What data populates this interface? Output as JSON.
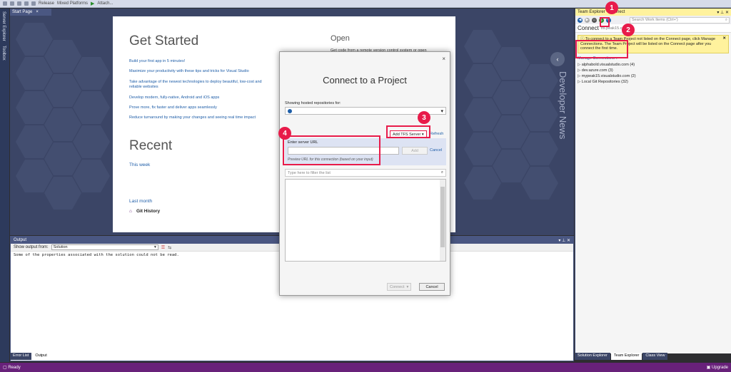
{
  "toolbar": {
    "config": "Release",
    "platform": "Mixed Platforms",
    "attach": "Attach..."
  },
  "left_tabs": [
    "Server Explorer",
    "Toolbox"
  ],
  "start_page": {
    "tab_label": "Start Page",
    "tab_close": "×",
    "get_started": "Get Started",
    "links": [
      "Build your first app in 5 minutes!",
      "Maximize your productivity with these tips and tricks for Visual Studio",
      "Take advantage of the newest technologies to deploy beautiful, low-cost and",
      "reliable websites",
      "Develop modern, fully-native, Android and iOS apps",
      "Prove more, fix faster and deliver apps seamlessly",
      "Reduce turnaround by making your changes and seeing real time impact"
    ],
    "open_heading": "Open",
    "open_sub": "Get code from a remote version control system or open",
    "recent_heading": "Recent",
    "this_week": "This week",
    "last_month": "Last month",
    "git_history": "Git History"
  },
  "developer_news": {
    "label": "Developer News",
    "toggle": "‹"
  },
  "output": {
    "title": "Output",
    "pin": "▾ ⊥ ✕",
    "show_from_label": "Show output from:",
    "source": "Solution",
    "message": "Some of the properties associated with the solution could not be read."
  },
  "bottom_tabs": [
    "Error List",
    "Output"
  ],
  "status": {
    "ready": "Ready",
    "upgrade": "Upgrade"
  },
  "team_explorer": {
    "title": "Team Explorer - Connect",
    "title_controls": "▾ ⊥ ✕",
    "search_placeholder": "Search Work Items (Ctrl+')",
    "connect_label": "Connect",
    "server": "tfs.peak15.com",
    "info_message": "To connect to a Team Project not listed on the Connect page, click Manage Connections. The Team Project will be listed on the Connect page after you connect the first time.",
    "manage_connections": "Manage Connections ▾",
    "items": [
      "alphabold.visualstudio.com (4)",
      "dev.azure.com (3)",
      "mypeak15.visualstudio.com (2)",
      "Local Git Repositories (32)"
    ],
    "tabs": [
      "Solution Explorer",
      "Team Explorer",
      "Class View"
    ]
  },
  "dialog": {
    "close": "×",
    "title": "Connect to a Project",
    "showing_label": "Showing hosted repositories for:",
    "add_tfs": "Add TFS Server ▾",
    "refresh": "Refresh",
    "enter_url_label": "Enter server URL",
    "add_button": "Add",
    "cancel_link": "Cancel",
    "preview_text": "Preview URL for this connection (based on your input)",
    "filter_placeholder": "Type here to filter the list",
    "connect_button": "Connect",
    "cancel_button": "Cancel"
  },
  "callouts": [
    "1",
    "2",
    "3",
    "4"
  ],
  "colors": {
    "callout": "#e81b4a",
    "status_bar": "#68217a",
    "info_bar": "#fff29d"
  }
}
